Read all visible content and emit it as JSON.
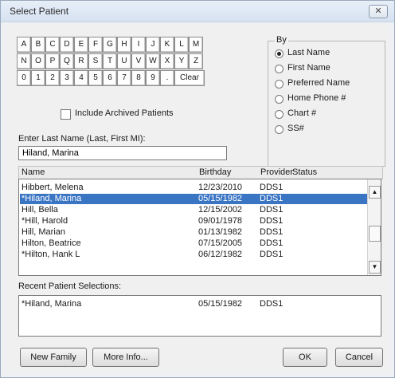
{
  "window": {
    "title": "Select Patient",
    "close_glyph": "✕"
  },
  "keys": [
    [
      "A",
      "B",
      "C",
      "D",
      "E",
      "F",
      "G",
      "H",
      "I",
      "J",
      "K",
      "L",
      "M"
    ],
    [
      "N",
      "O",
      "P",
      "Q",
      "R",
      "S",
      "T",
      "U",
      "V",
      "W",
      "X",
      "Y",
      "Z"
    ],
    [
      "0",
      "1",
      "2",
      "3",
      "4",
      "5",
      "6",
      "7",
      "8",
      "9",
      "."
    ]
  ],
  "clear_label": "Clear",
  "include_archived": {
    "label": "Include Archived Patients",
    "checked": false
  },
  "by": {
    "legend": "By",
    "options": [
      "Last Name",
      "First Name",
      "Preferred Name",
      "Home Phone #",
      "Chart #",
      "SS#"
    ],
    "selected": "Last Name"
  },
  "search": {
    "label": "Enter Last Name (Last, First MI):",
    "value": "Hiland, Marina"
  },
  "columns": {
    "name": "Name",
    "birthday": "Birthday",
    "provider": "Provider",
    "status": "Status"
  },
  "patients": [
    {
      "name": "Hibbert, Melena",
      "birthday": "12/23/2010",
      "provider": "DDS1",
      "status": "",
      "selected": false
    },
    {
      "name": "*Hiland, Marina",
      "birthday": "05/15/1982",
      "provider": "DDS1",
      "status": "",
      "selected": true
    },
    {
      "name": "Hill, Bella",
      "birthday": "12/15/2002",
      "provider": "DDS1",
      "status": "",
      "selected": false
    },
    {
      "name": "*Hill, Harold",
      "birthday": "09/01/1978",
      "provider": "DDS1",
      "status": "",
      "selected": false
    },
    {
      "name": "Hill, Marian",
      "birthday": "01/13/1982",
      "provider": "DDS1",
      "status": "",
      "selected": false
    },
    {
      "name": "Hilton, Beatrice",
      "birthday": "07/15/2005",
      "provider": "DDS1",
      "status": "",
      "selected": false
    },
    {
      "name": "*Hilton, Hank L",
      "birthday": "06/12/1982",
      "provider": "DDS1",
      "status": "",
      "selected": false
    }
  ],
  "recent": {
    "label": "Recent Patient Selections:",
    "items": [
      {
        "name": "*Hiland, Marina",
        "birthday": "05/15/1982",
        "provider": "DDS1"
      }
    ]
  },
  "buttons": {
    "new_family": "New Family",
    "more_info": "More Info...",
    "ok": "OK",
    "cancel": "Cancel"
  },
  "scroll_glyphs": {
    "up": "▲",
    "down": "▼"
  }
}
